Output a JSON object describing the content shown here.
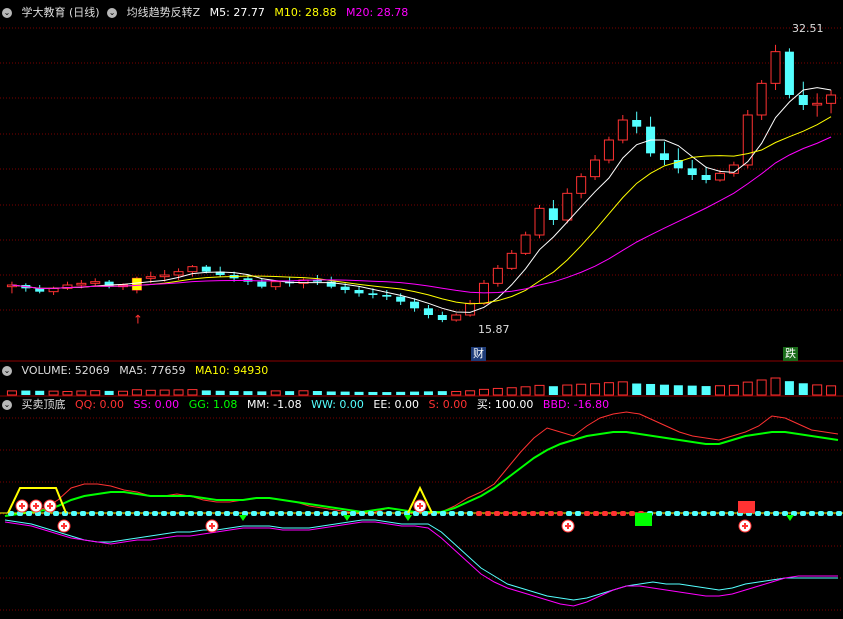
{
  "colors": {
    "up": "#ff3232",
    "down": "#54ffff",
    "ma5": "#ffffff",
    "ma10": "#ffff00",
    "ma20": "#ff00ff",
    "grid": "#7a0000",
    "sep": "#8b0000",
    "green": "#00ff00",
    "cyan": "#54ffff",
    "white": "#ffffff",
    "magenta": "#ff00ff",
    "yellow": "#ffff00"
  },
  "main_panel": {
    "title": "学大教育 (日线)",
    "indicator": "均线趋势反转Z",
    "ma5": "M5: 27.77",
    "ma10": "M10: 28.88",
    "ma20": "M20: 28.78",
    "high_label": "32.51",
    "low_label": "15.87",
    "tag_cai": "财",
    "tag_die": "跌"
  },
  "volume_panel": {
    "label": "VOLUME: 52069",
    "ma5": "MA5: 77659",
    "ma10": "MA10: 94930"
  },
  "indicator_panel": {
    "title": "买卖顶底",
    "qq": "QQ: 0.00",
    "ss": "SS: 0.00",
    "gg": "GG: 1.08",
    "mm": "MM: -1.08",
    "ww": "WW: 0.00",
    "ee": "EE: 0.00",
    "s": "S: 0.00",
    "buy": "买: 100.00",
    "bbd": "BBD: -16.80"
  },
  "chart_data": [
    {
      "type": "candlestick",
      "title": "学大教育 (日线)",
      "series_meta": [
        "M5",
        "M10",
        "M20"
      ],
      "ylim": [
        14.5,
        34.0
      ],
      "candles": [
        [
          18.0,
          18.3,
          17.6,
          18.1
        ],
        [
          18.1,
          18.2,
          17.7,
          17.9
        ],
        [
          17.9,
          18.1,
          17.6,
          17.7
        ],
        [
          17.7,
          18.0,
          17.5,
          17.9
        ],
        [
          17.9,
          18.3,
          17.8,
          18.1
        ],
        [
          18.1,
          18.4,
          17.9,
          18.2
        ],
        [
          18.2,
          18.5,
          18.0,
          18.3
        ],
        [
          18.3,
          18.4,
          17.9,
          18.0
        ],
        [
          18.0,
          18.2,
          17.8,
          18.1
        ],
        [
          17.8,
          18.6,
          17.6,
          18.5
        ],
        [
          18.5,
          18.9,
          18.2,
          18.6
        ],
        [
          18.6,
          19.0,
          18.3,
          18.7
        ],
        [
          18.7,
          19.1,
          18.4,
          18.9
        ],
        [
          18.9,
          19.3,
          18.6,
          19.2
        ],
        [
          19.2,
          19.3,
          18.8,
          18.9
        ],
        [
          18.9,
          19.2,
          18.6,
          18.7
        ],
        [
          18.7,
          18.9,
          18.3,
          18.5
        ],
        [
          18.5,
          18.7,
          18.1,
          18.3
        ],
        [
          18.3,
          18.5,
          17.9,
          18.0
        ],
        [
          18.0,
          18.4,
          17.8,
          18.3
        ],
        [
          18.3,
          18.6,
          18.0,
          18.2
        ],
        [
          18.2,
          18.5,
          17.9,
          18.4
        ],
        [
          18.4,
          18.7,
          18.1,
          18.3
        ],
        [
          18.3,
          18.6,
          17.9,
          18.0
        ],
        [
          18.0,
          18.2,
          17.6,
          17.8
        ],
        [
          17.8,
          18.0,
          17.4,
          17.6
        ],
        [
          17.6,
          17.9,
          17.3,
          17.5
        ],
        [
          17.5,
          17.8,
          17.2,
          17.4
        ],
        [
          17.4,
          17.6,
          16.9,
          17.1
        ],
        [
          17.1,
          17.3,
          16.5,
          16.7
        ],
        [
          16.7,
          16.9,
          16.1,
          16.3
        ],
        [
          16.3,
          16.5,
          15.87,
          16.0
        ],
        [
          16.0,
          16.4,
          15.9,
          16.3
        ],
        [
          16.3,
          17.2,
          16.2,
          17.0
        ],
        [
          17.0,
          18.4,
          16.9,
          18.2
        ],
        [
          18.2,
          19.3,
          18.0,
          19.1
        ],
        [
          19.1,
          20.2,
          19.0,
          20.0
        ],
        [
          20.0,
          21.3,
          19.9,
          21.1
        ],
        [
          21.1,
          22.9,
          20.9,
          22.7
        ],
        [
          22.7,
          23.2,
          21.7,
          22.0
        ],
        [
          22.0,
          23.9,
          21.8,
          23.6
        ],
        [
          23.6,
          24.8,
          23.3,
          24.6
        ],
        [
          24.6,
          25.9,
          24.4,
          25.6
        ],
        [
          25.6,
          27.0,
          25.4,
          26.8
        ],
        [
          26.8,
          28.3,
          26.6,
          28.0
        ],
        [
          28.0,
          28.5,
          27.2,
          27.6
        ],
        [
          27.6,
          28.2,
          25.8,
          26.0
        ],
        [
          26.0,
          26.7,
          25.3,
          25.6
        ],
        [
          25.6,
          26.3,
          24.8,
          25.1
        ],
        [
          25.1,
          25.6,
          24.4,
          24.7
        ],
        [
          24.7,
          25.2,
          24.2,
          24.4
        ],
        [
          24.4,
          25.0,
          24.3,
          24.8
        ],
        [
          24.8,
          25.5,
          24.6,
          25.3
        ],
        [
          25.3,
          28.6,
          25.1,
          28.3
        ],
        [
          28.3,
          30.4,
          28.0,
          30.2
        ],
        [
          30.2,
          32.51,
          29.8,
          32.1
        ],
        [
          32.1,
          32.3,
          29.3,
          29.5
        ],
        [
          29.5,
          30.3,
          28.6,
          28.9
        ],
        [
          28.9,
          29.6,
          28.2,
          29.0
        ],
        [
          29.0,
          29.8,
          28.4,
          29.5
        ]
      ]
    },
    {
      "type": "bar",
      "title": "VOLUME: 52069",
      "series_meta": [
        "MA5: 77659",
        "MA10: 94930"
      ],
      "values": [
        35,
        38,
        36,
        33,
        30,
        34,
        37,
        35,
        32,
        45,
        40,
        42,
        44,
        46,
        39,
        36,
        34,
        33,
        31,
        35,
        33,
        36,
        34,
        30,
        29,
        27,
        26,
        25,
        27,
        29,
        31,
        33,
        30,
        36,
        48,
        56,
        62,
        70,
        82,
        75,
        85,
        92,
        96,
        105,
        112,
        98,
        94,
        88,
        83,
        80,
        76,
        79,
        82,
        110,
        128,
        145,
        118,
        100,
        86,
        78
      ]
    },
    {
      "type": "line",
      "title": "买卖顶底",
      "series_meta": [
        "QQ",
        "SS",
        "GG",
        "MM",
        "WW",
        "EE",
        "S",
        "买",
        "BBD"
      ],
      "red": [
        48,
        49,
        50,
        52,
        56,
        62,
        64,
        64,
        63,
        61,
        60,
        58,
        58,
        59,
        58,
        56,
        55,
        55,
        56,
        57,
        57,
        56,
        55,
        53,
        52,
        51,
        50,
        49,
        50,
        52,
        51,
        50,
        49,
        50,
        53,
        57,
        60,
        64,
        72,
        80,
        87,
        92,
        90,
        88,
        93,
        97,
        99,
        100,
        99,
        96,
        93,
        90,
        88,
        87,
        86,
        88,
        90,
        93,
        98,
        97,
        94,
        91,
        90,
        89
      ],
      "green": [
        48,
        49,
        50,
        51,
        53,
        56,
        58,
        59,
        60,
        60,
        59,
        58,
        58,
        58,
        58,
        57,
        56,
        56,
        56,
        57,
        57,
        56,
        55,
        54,
        53,
        52,
        51,
        50,
        51,
        52,
        51,
        50,
        50,
        50,
        52,
        55,
        58,
        62,
        67,
        72,
        77,
        81,
        84,
        86,
        88,
        89,
        90,
        90,
        89,
        88,
        87,
        86,
        85,
        84,
        84,
        86,
        88,
        89,
        90,
        90,
        89,
        88,
        87,
        86
      ],
      "cyan": [
        46,
        45,
        44,
        42,
        40,
        38,
        36,
        35,
        35,
        36,
        37,
        38,
        39,
        40,
        40,
        41,
        41,
        42,
        43,
        43,
        43,
        42,
        42,
        42,
        43,
        44,
        45,
        46,
        46,
        45,
        44,
        44,
        44,
        40,
        34,
        28,
        22,
        18,
        14,
        12,
        10,
        8,
        7,
        6,
        7,
        9,
        11,
        13,
        14,
        15,
        14,
        14,
        13,
        12,
        11,
        12,
        14,
        15,
        16,
        17,
        17,
        17,
        17,
        17
      ],
      "pink": [
        45,
        44,
        43,
        41,
        39,
        37,
        36,
        35,
        34,
        35,
        36,
        36,
        37,
        38,
        38,
        39,
        40,
        41,
        42,
        42,
        42,
        41,
        41,
        41,
        42,
        43,
        44,
        45,
        45,
        44,
        43,
        43,
        42,
        37,
        31,
        25,
        19,
        15,
        12,
        10,
        8,
        6,
        4,
        3,
        5,
        8,
        11,
        13,
        13,
        12,
        11,
        10,
        9,
        8,
        8,
        9,
        11,
        13,
        15,
        17,
        18,
        18,
        18,
        18
      ]
    }
  ]
}
